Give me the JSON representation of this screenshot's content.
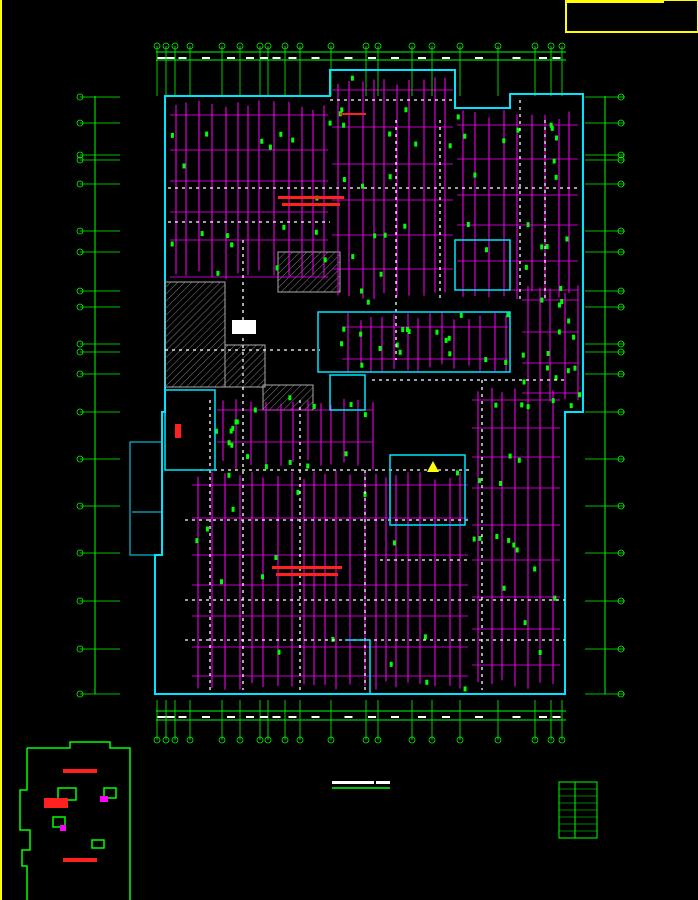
{
  "drawing": {
    "title_block_text": "",
    "colors": {
      "background": "#000000",
      "grid": "#00ff00",
      "wall": "#00e5ff",
      "piping": "#ff00ff",
      "dashed": "#ffffff",
      "hatch": "#808080",
      "note": "#ff0000",
      "warning": "#ffff00",
      "frame": "#ffff00"
    },
    "warning_symbol": "warning-triangle-icon",
    "grid_bubbles_top": [
      "1",
      "2",
      "3",
      "4",
      "5",
      "6",
      "7",
      "8",
      "9",
      "10",
      "11",
      "12",
      "13",
      "14",
      "15",
      "16",
      "17",
      "18"
    ],
    "grid_bubbles_left": [
      "A",
      "B",
      "C",
      "D",
      "E",
      "F",
      "G",
      "H",
      "J",
      "K",
      "L",
      "M",
      "N",
      "P",
      "Q",
      "R",
      "S"
    ]
  }
}
